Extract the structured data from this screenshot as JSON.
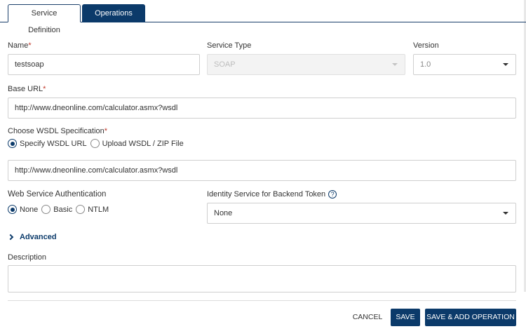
{
  "tabs": [
    {
      "label": "Service Definition",
      "active": true
    },
    {
      "label": "Operations List",
      "active": false
    }
  ],
  "form": {
    "name": {
      "label": "Name",
      "required_mark": "*",
      "value": "testsoap"
    },
    "service_type": {
      "label": "Service Type",
      "value": "SOAP",
      "disabled": true
    },
    "version": {
      "label": "Version",
      "value": "1.0"
    },
    "base_url": {
      "label": "Base URL",
      "required_mark": "*",
      "value": "http://www.dneonline.com/calculator.asmx?wsdl"
    },
    "wsdl_spec": {
      "label": "Choose WSDL Specification",
      "required_mark": "*",
      "options": [
        {
          "label": "Specify WSDL URL",
          "selected": true
        },
        {
          "label": "Upload WSDL / ZIP File",
          "selected": false
        }
      ],
      "url_value": "http://www.dneonline.com/calculator.asmx?wsdl"
    },
    "auth": {
      "label": "Web Service Authentication",
      "options": [
        {
          "label": "None",
          "selected": true
        },
        {
          "label": "Basic",
          "selected": false
        },
        {
          "label": "NTLM",
          "selected": false
        }
      ]
    },
    "identity_service": {
      "label": "Identity Service for Backend Token",
      "help_icon": "?",
      "value": "None"
    },
    "advanced": {
      "label": "Advanced"
    },
    "description": {
      "label": "Description",
      "value": ""
    }
  },
  "footer": {
    "cancel_label": "CANCEL",
    "save_label": "SAVE",
    "save_add_label": "SAVE & ADD OPERATION"
  },
  "colors": {
    "primary": "#0b3a6a",
    "required": "#c0392b",
    "border": "#cfcfcf"
  },
  "icons": [
    "chevron-down-icon",
    "chevron-right-icon",
    "help-icon"
  ]
}
